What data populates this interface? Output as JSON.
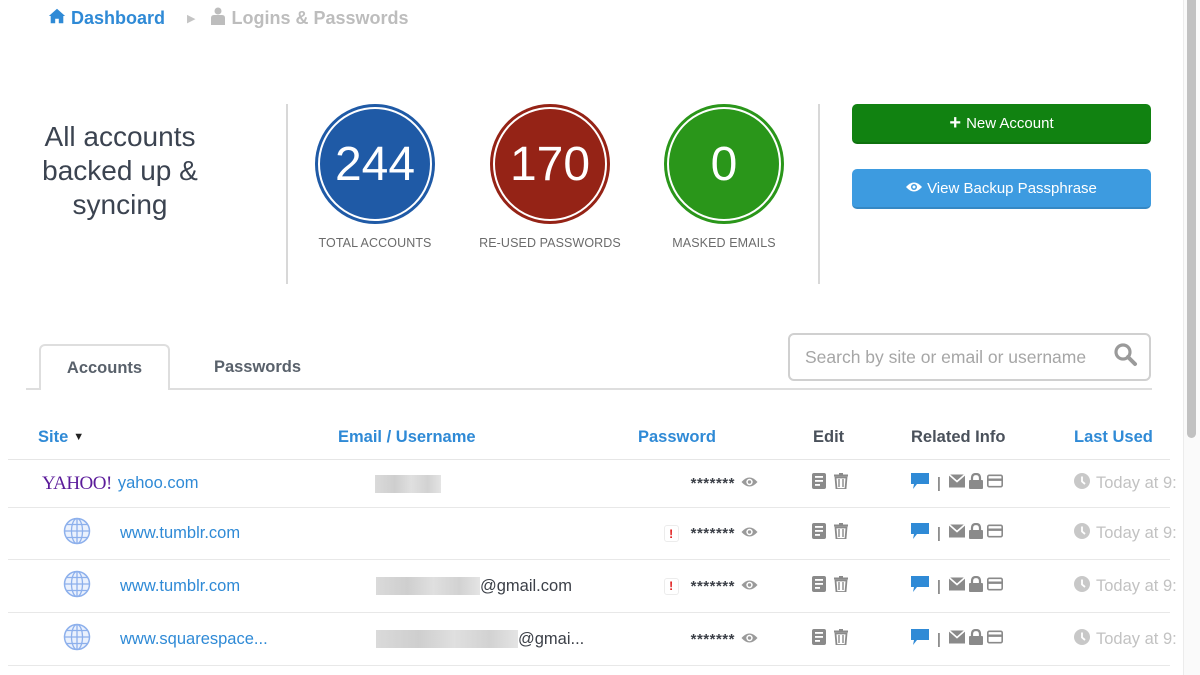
{
  "breadcrumb": {
    "home_label": "Dashboard",
    "current_label": "Logins & Passwords"
  },
  "summary": {
    "status_lines": [
      "All accounts",
      "backed up &",
      "syncing"
    ],
    "stats": [
      {
        "value": "244",
        "label": "TOTAL ACCOUNTS",
        "color": "#1f5aa6"
      },
      {
        "value": "170",
        "label": "RE-USED PASSWORDS",
        "color": "#952316"
      },
      {
        "value": "0",
        "label": "MASKED EMAILS",
        "color": "#2a961a"
      }
    ]
  },
  "actions": {
    "new_account_label": "New Account",
    "view_backup_label": "View Backup Passphrase"
  },
  "tabs": [
    {
      "label": "Accounts",
      "active": true
    },
    {
      "label": "Passwords",
      "active": false
    }
  ],
  "search": {
    "placeholder": "Search by site or email or username",
    "value": ""
  },
  "table": {
    "columns": {
      "site": "Site",
      "email": "Email / Username",
      "password": "Password",
      "edit": "Edit",
      "related": "Related Info",
      "last_used": "Last Used"
    },
    "sort_column": "site",
    "rows": [
      {
        "logo": "YAHOO!",
        "site": "yahoo.com",
        "email_suffix": "",
        "reused": false,
        "password": "*******",
        "last_used": "Today at 9:"
      },
      {
        "logo": "",
        "site": "www.tumblr.com",
        "email_suffix": "",
        "reused": true,
        "password": "*******",
        "last_used": "Today at 9:"
      },
      {
        "logo": "",
        "site": "www.tumblr.com",
        "email_suffix": "@gmail.com",
        "reused": true,
        "password": "*******",
        "last_used": "Today at 9:"
      },
      {
        "logo": "",
        "site": "www.squarespace...",
        "email_suffix": "@gmai...",
        "reused": false,
        "password": "*******",
        "last_used": "Today at 9:"
      }
    ]
  },
  "colors": {
    "accent_blue": "#2f8ad6",
    "new_account_green": "#118211",
    "view_backup_blue": "#3d9be0",
    "warning_red": "#e01b1b"
  }
}
